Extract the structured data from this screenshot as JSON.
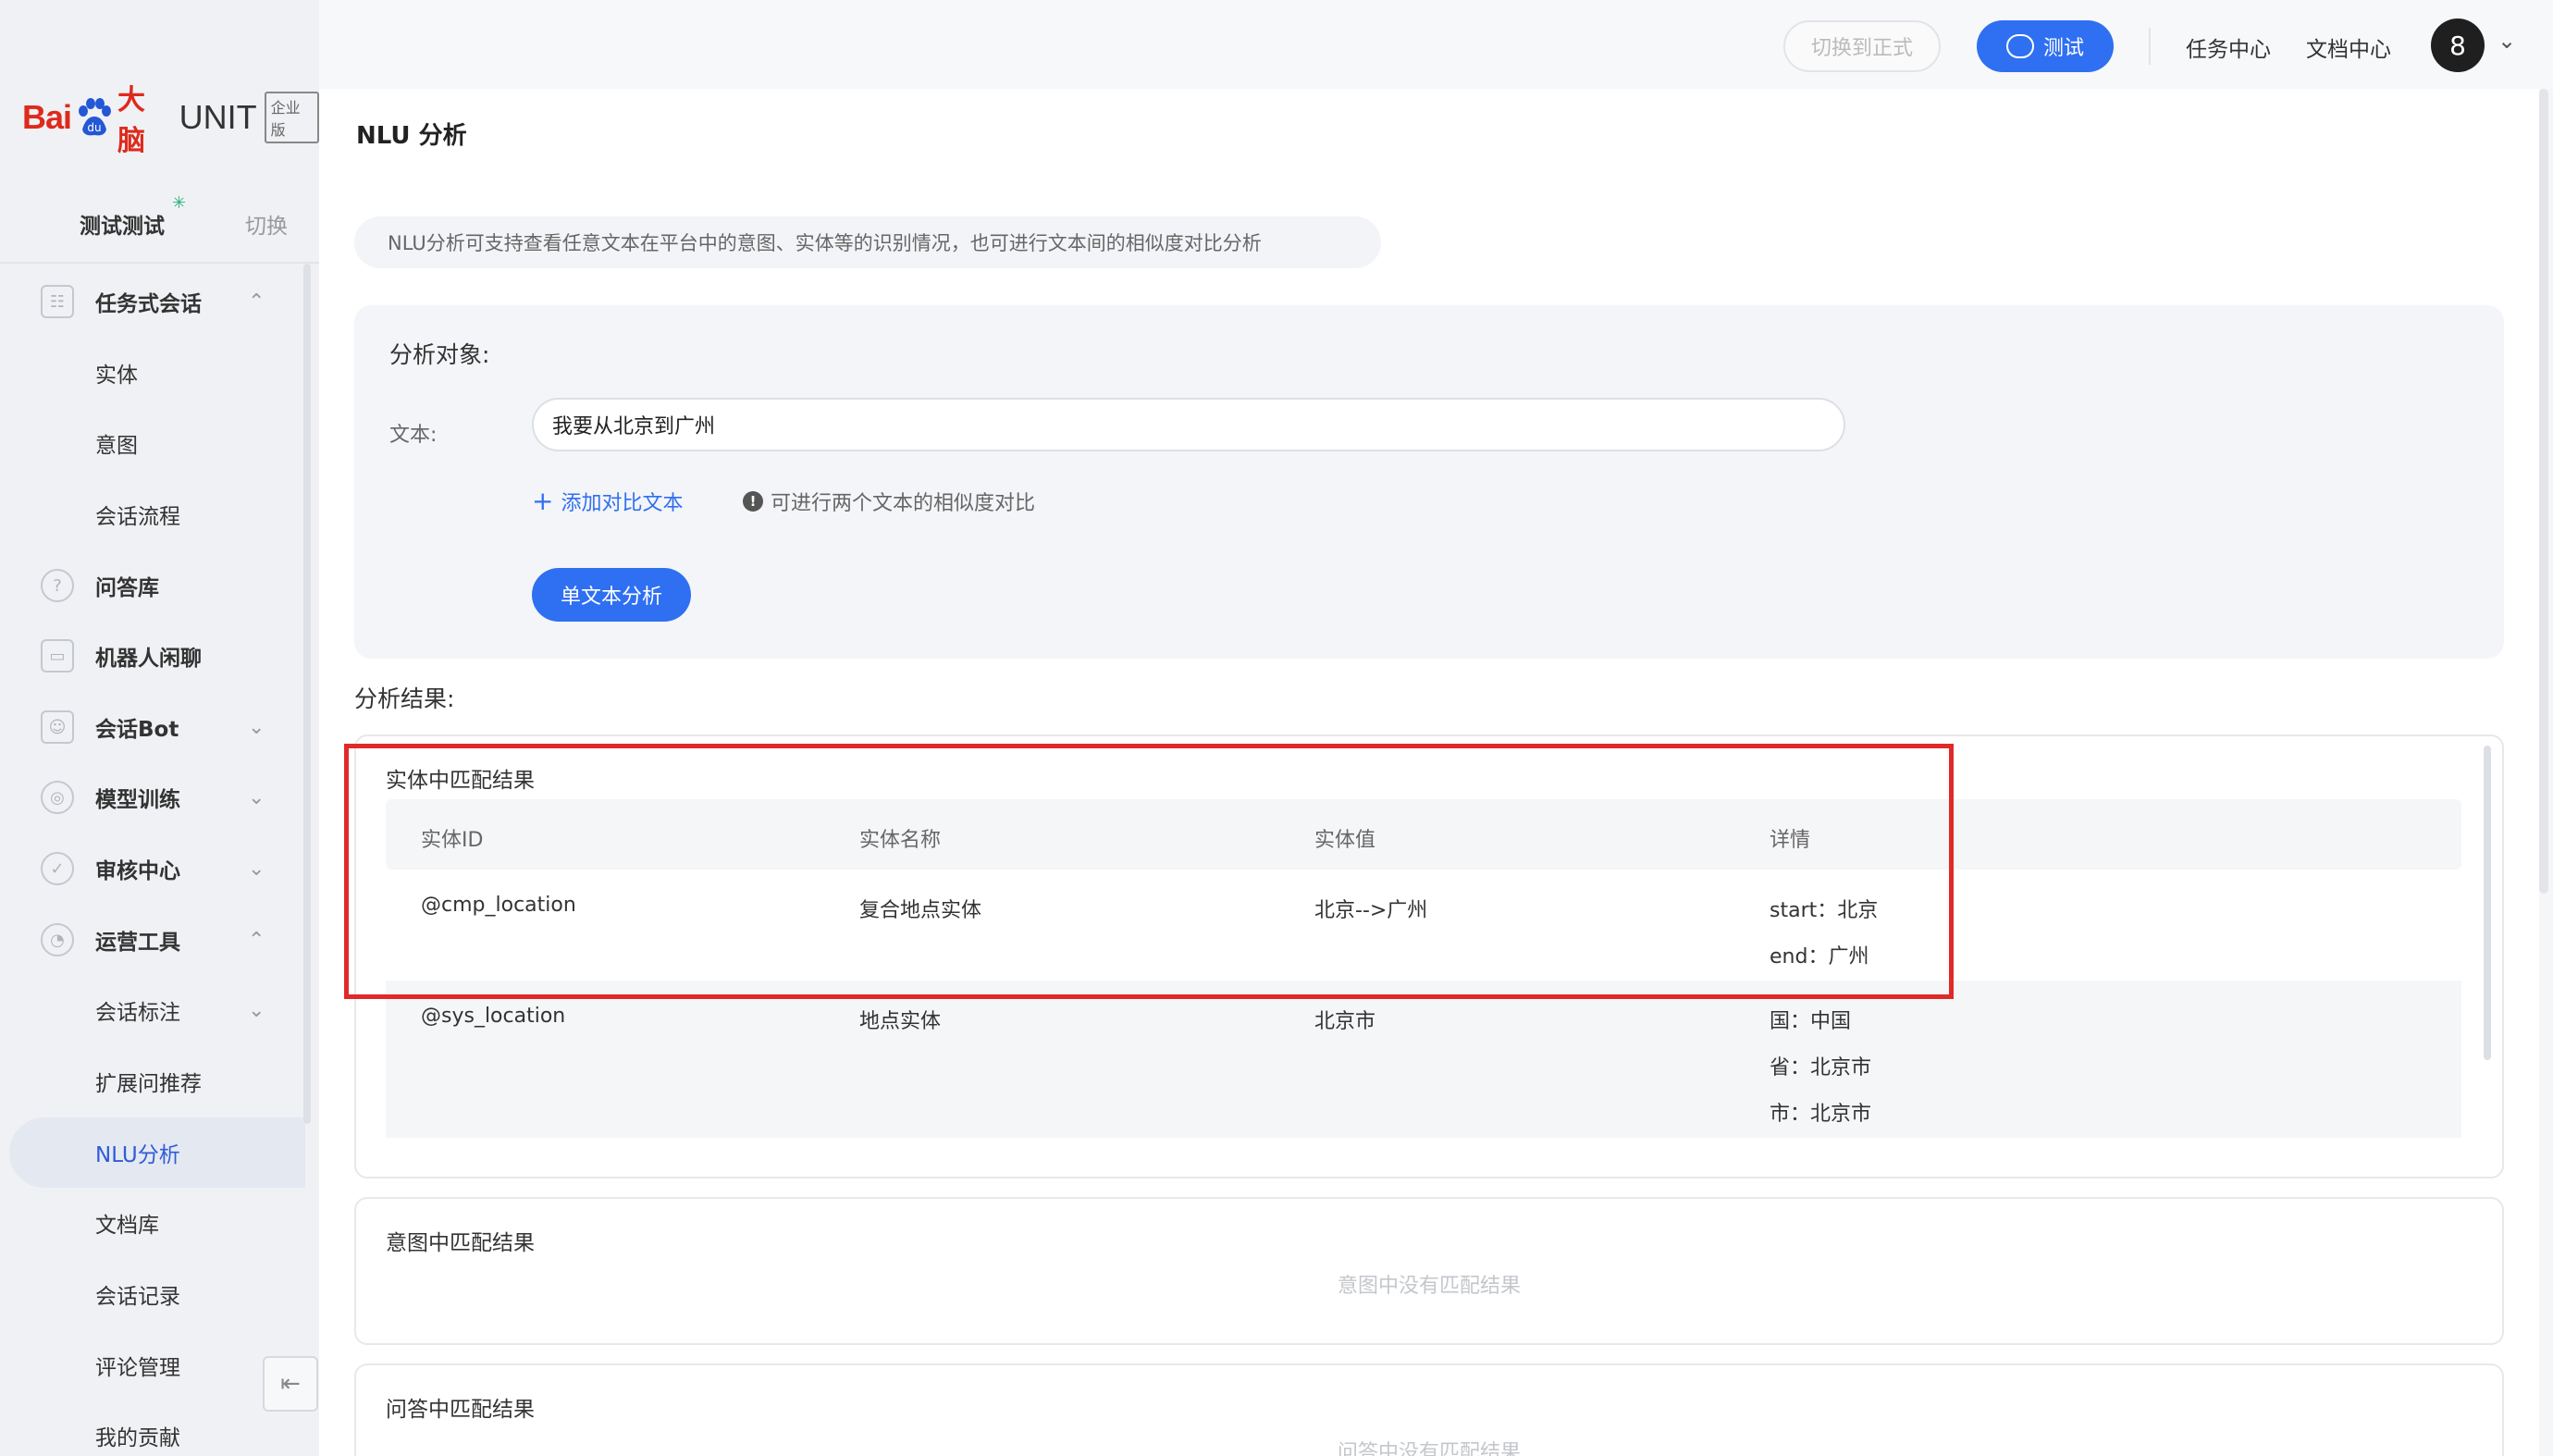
{
  "brand": {
    "bai": "Bai",
    "danao": "大脑",
    "unit": "UNIT",
    "edition": "企业版"
  },
  "workspace": {
    "name": "测试测试",
    "switch_label": "切换"
  },
  "sidebar": {
    "items": [
      {
        "label": "任务式会话",
        "chev": "⌃"
      },
      {
        "label": "实体"
      },
      {
        "label": "意图"
      },
      {
        "label": "会话流程"
      },
      {
        "label": "问答库"
      },
      {
        "label": "机器人闲聊"
      },
      {
        "label": "会话Bot",
        "chev": "⌄"
      },
      {
        "label": "模型训练",
        "chev": "⌄"
      },
      {
        "label": "审核中心",
        "chev": "⌄"
      },
      {
        "label": "运营工具",
        "chev": "⌃"
      },
      {
        "label": "会话标注",
        "chev": "⌄"
      },
      {
        "label": "扩展问推荐"
      },
      {
        "label": "NLU分析"
      },
      {
        "label": "文档库"
      },
      {
        "label": "会话记录"
      },
      {
        "label": "评论管理"
      },
      {
        "label": "我的贡献"
      }
    ]
  },
  "header": {
    "switch_formal": "切换到正式",
    "test": "测试",
    "task_center": "任务中心",
    "doc_center": "文档中心",
    "avatar": "8"
  },
  "page": {
    "title": "NLU 分析",
    "tip": "NLU分析可支持查看任意文本在平台中的意图、实体等的识别情况，也可进行文本间的相似度对比分析",
    "analyze_target": "分析对象:",
    "text_label": "文本:",
    "text_value": "我要从北京到广州",
    "add_compare": "添加对比文本",
    "compare_tip": "可进行两个文本的相似度对比",
    "single_btn": "单文本分析",
    "result_title": "分析结果:"
  },
  "entity_result": {
    "title": "实体中匹配结果",
    "columns": [
      "实体ID",
      "实体名称",
      "实体值",
      "详情"
    ],
    "rows": [
      {
        "id": "@cmp_location",
        "name": "复合地点实体",
        "value": "北京-->广州",
        "details": [
          "start：北京",
          "end：广州"
        ]
      },
      {
        "id": "@sys_location",
        "name": "地点实体",
        "value": "北京市",
        "details": [
          "国：中国",
          "省：北京市",
          "市：北京市"
        ]
      }
    ]
  },
  "intent_result": {
    "title": "意图中匹配结果",
    "empty": "意图中没有匹配结果"
  },
  "qa_result": {
    "title": "问答中匹配结果",
    "empty": "问答中没有匹配结果"
  },
  "colors": {
    "primary": "#2f6ff2",
    "highlight": "#e02a2a",
    "brand_red": "#de2a1c"
  }
}
